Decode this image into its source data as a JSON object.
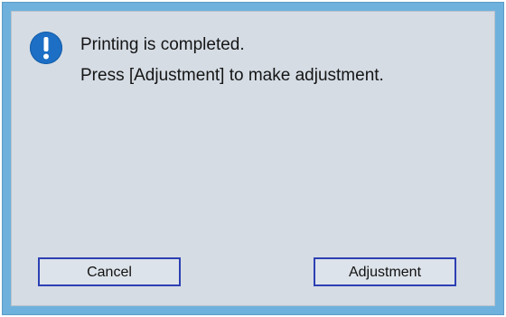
{
  "dialog": {
    "icon": "exclamation-icon",
    "message_lines": [
      "Printing is completed.",
      "Press [Adjustment] to make adjustment."
    ],
    "buttons": {
      "cancel_label": "Cancel",
      "adjustment_label": "Adjustment"
    }
  },
  "colors": {
    "frame": "#6fb1dd",
    "panel": "#d5dce4",
    "icon": "#1c6fc4",
    "button_border": "#2d40b3"
  }
}
